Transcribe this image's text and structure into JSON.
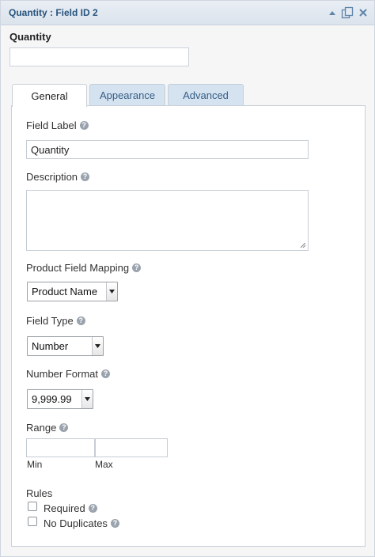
{
  "titlebar": {
    "title": "Quantity : Field ID 2",
    "icons": [
      "collapse-arrow-icon",
      "duplicate-icon",
      "close-icon"
    ]
  },
  "preview": {
    "label": "Quantity",
    "value": ""
  },
  "tabs": [
    {
      "label": "General",
      "active": true
    },
    {
      "label": "Appearance",
      "active": false
    },
    {
      "label": "Advanced",
      "active": false
    }
  ],
  "general": {
    "field_label": {
      "label": "Field Label",
      "value": "Quantity"
    },
    "description": {
      "label": "Description",
      "value": ""
    },
    "product_field_mapping": {
      "label": "Product Field Mapping",
      "selected": "Product Name"
    },
    "field_type": {
      "label": "Field Type",
      "selected": "Number"
    },
    "number_format": {
      "label": "Number Format",
      "selected": "9,999.99"
    },
    "range": {
      "label": "Range",
      "min_label": "Min",
      "max_label": "Max",
      "min": "",
      "max": ""
    },
    "rules": {
      "label": "Rules",
      "required": {
        "label": "Required",
        "checked": false
      },
      "no_duplicates": {
        "label": "No Duplicates",
        "checked": false
      }
    }
  },
  "help_glyph": "?",
  "colors": {
    "titlebar_text": "#27537e",
    "inactive_tab_bg": "#d5e2f0",
    "inactive_tab_text": "#375f86"
  }
}
